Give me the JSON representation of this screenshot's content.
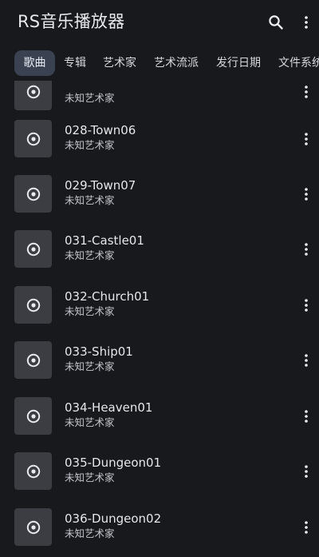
{
  "app": {
    "title": "RS音乐播放器"
  },
  "icons": {
    "search": "search-icon",
    "more": "more-vert-icon",
    "disc": "disc-icon"
  },
  "colors": {
    "background": "#17191d",
    "active_tab": "#3a4251",
    "thumbnail": "#3b3d42"
  },
  "tabs": [
    {
      "label": "歌曲",
      "active": true
    },
    {
      "label": "专辑",
      "active": false
    },
    {
      "label": "艺术家",
      "active": false
    },
    {
      "label": "艺术流派",
      "active": false
    },
    {
      "label": "发行日期",
      "active": false
    },
    {
      "label": "文件系统",
      "active": false
    }
  ],
  "songs": [
    {
      "title": "",
      "artist": "未知艺术家"
    },
    {
      "title": "028-Town06",
      "artist": "未知艺术家"
    },
    {
      "title": "029-Town07",
      "artist": "未知艺术家"
    },
    {
      "title": "031-Castle01",
      "artist": "未知艺术家"
    },
    {
      "title": "032-Church01",
      "artist": "未知艺术家"
    },
    {
      "title": "033-Ship01",
      "artist": "未知艺术家"
    },
    {
      "title": "034-Heaven01",
      "artist": "未知艺术家"
    },
    {
      "title": "035-Dungeon01",
      "artist": "未知艺术家"
    },
    {
      "title": "036-Dungeon02",
      "artist": "未知艺术家"
    }
  ]
}
